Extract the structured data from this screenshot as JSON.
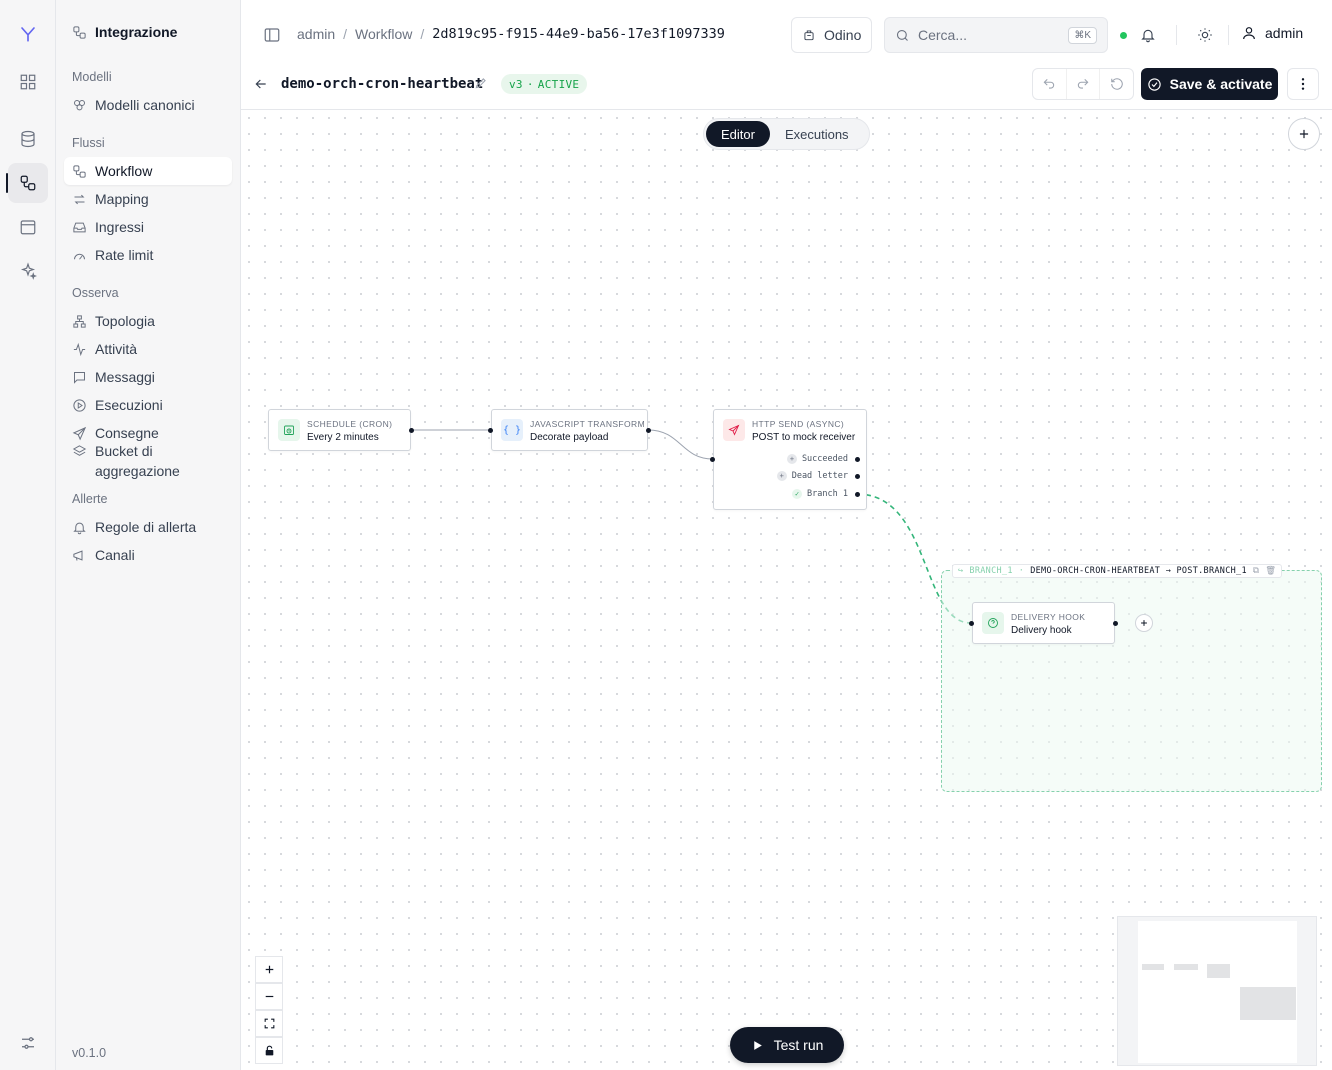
{
  "sidebar": {
    "title": "Integrazione",
    "sections": {
      "models": "Modelli",
      "flows": "Flussi",
      "observe": "Osserva",
      "alerts": "Allerte"
    },
    "items": {
      "canonical_models": "Modelli canonici",
      "workflow": "Workflow",
      "mapping": "Mapping",
      "ingress": "Ingressi",
      "rate_limit": "Rate limit",
      "topology": "Topologia",
      "activity": "Attività",
      "messages": "Messaggi",
      "executions": "Esecuzioni",
      "deliveries": "Consegne",
      "aggregation_buckets": "Bucket di aggregazione",
      "alert_rules": "Regole di allerta",
      "channels": "Canali"
    },
    "version": "v0.1.0"
  },
  "header": {
    "breadcrumb": [
      "admin",
      "Workflow",
      "2d819c95-f915-44e9-ba56-17e3f1097339"
    ],
    "tenant_button": "Odino",
    "search_placeholder": "Cerca...",
    "search_shortcut": "⌘K",
    "user": "admin"
  },
  "workflow": {
    "name": "demo-orch-cron-heartbeat",
    "version": "v3",
    "status": "ACTIVE",
    "save_label": "Save & activate"
  },
  "canvas": {
    "tabs": [
      "Editor",
      "Executions"
    ],
    "active_tab": "Editor",
    "test_run_label": "Test run",
    "nodes": {
      "schedule": {
        "type": "SCHEDULE (CRON)",
        "label": "Every 2 minutes"
      },
      "transform": {
        "type": "JAVASCRIPT TRANSFORM",
        "label": "Decorate payload"
      },
      "http": {
        "type": "HTTP SEND (ASYNC)",
        "label": "POST to mock receiver",
        "outputs": [
          "Succeeded",
          "Dead letter",
          "Branch 1"
        ]
      },
      "delivery": {
        "type": "DELIVERY HOOK",
        "label": "Delivery hook"
      }
    },
    "branch": {
      "tag": "BRANCH_1",
      "name": "DEMO-ORCH-CRON-HEARTBEAT → POST.BRANCH_1"
    }
  },
  "colors": {
    "accent": "#111827",
    "active_badge_bg": "#e8f6ec",
    "active_badge_text": "#16a34a",
    "branch_border": "#86d1ad",
    "status_online": "#22c55e"
  }
}
